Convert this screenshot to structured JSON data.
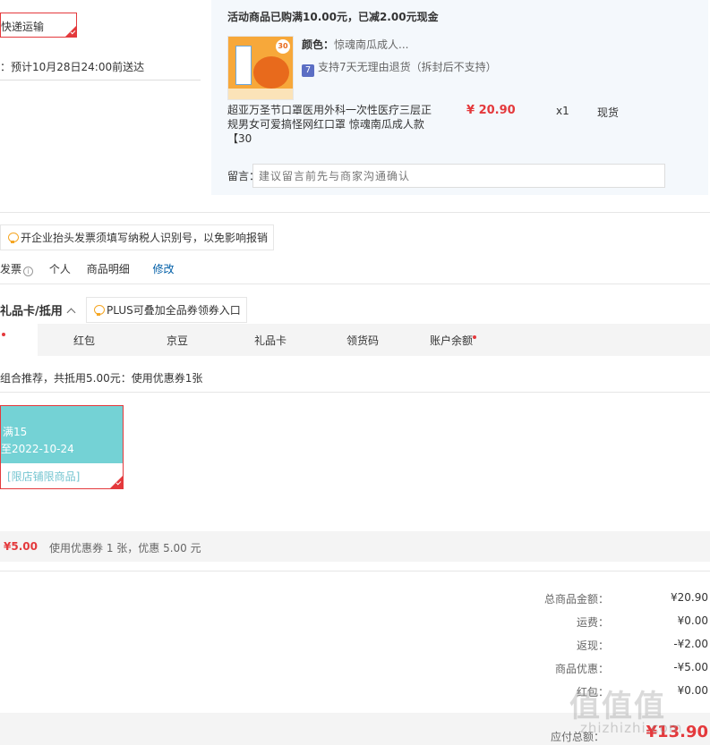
{
  "shipping": {
    "method": "快递运输",
    "eta": "：预计10月28日24:00前送达"
  },
  "product": {
    "promo": "活动商品已购满10.00元，已减2.00元现金",
    "thumb_badge": "30",
    "color_label": "颜色：",
    "color_value": "惊魂南瓜成人...",
    "return_icon": "7",
    "return_text": "支持7天无理由退货（拆封后不支持）",
    "name": "超亚万圣节口罩医用外科一次性医疗三层正规男女可爱搞怪网红口罩 惊魂南瓜成人款【30",
    "price": "¥ 20.90",
    "qty": "x1",
    "stock": "现货",
    "remark_label": "留言：",
    "remark_placeholder": "建议留言前先与商家沟通确认"
  },
  "invoice": {
    "tip": "开企业抬头发票须填写纳税人识别号，以免影响报销",
    "label": "发票",
    "info_icon": "i",
    "type": "个人",
    "content": "商品明细",
    "edit": "修改"
  },
  "gift": {
    "title": "礼品卡/抵用",
    "plus_tip": "PLUS可叠加全品券领券入口",
    "tabs": [
      "红包",
      "京豆",
      "礼品卡",
      "领货码",
      "账户余额"
    ],
    "combo": "组合推荐，共抵用5.00元：使用优惠券1张",
    "coupon": {
      "amount": "满15",
      "date": "至2022-10-24",
      "limit": "[限店铺限商品]"
    },
    "discount_amount": "¥5.00",
    "discount_text": "使用优惠券 1 张，优惠 5.00 元"
  },
  "summary": {
    "rows": [
      {
        "label": "总商品金额：",
        "value": "¥20.90"
      },
      {
        "label": "运费：",
        "value": "¥0.00"
      },
      {
        "label": "返现：",
        "value": "-¥2.00"
      },
      {
        "label": "商品优惠：",
        "value": "-¥5.00"
      },
      {
        "label": "红包：",
        "value": "¥0.00"
      }
    ],
    "total_label": "应付总额：",
    "total_value": "¥13.90"
  },
  "watermark": {
    "main": "值值值",
    "sub": "zhizhizhi.com"
  },
  "colors": {
    "accent": "#e4393c",
    "coupon": "#74d2d5",
    "link": "#005ea7"
  }
}
